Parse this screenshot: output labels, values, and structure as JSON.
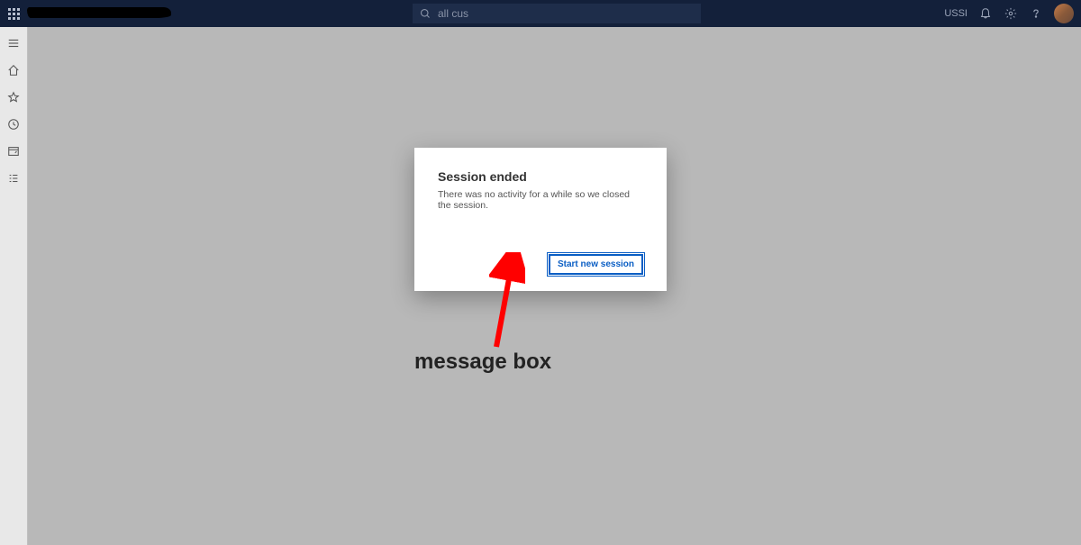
{
  "topbar": {
    "search_value": "all cus",
    "entity_label": "USSI"
  },
  "sidebar": {
    "items": [
      {
        "name": "hamburger-icon"
      },
      {
        "name": "home-icon"
      },
      {
        "name": "star-icon"
      },
      {
        "name": "recent-icon"
      },
      {
        "name": "workspace-icon"
      },
      {
        "name": "modules-icon"
      }
    ]
  },
  "dialog": {
    "title": "Session ended",
    "message": "There was no activity for a while so we closed the session.",
    "primary_button": "Start new session"
  },
  "annotation": {
    "label": "message box"
  }
}
